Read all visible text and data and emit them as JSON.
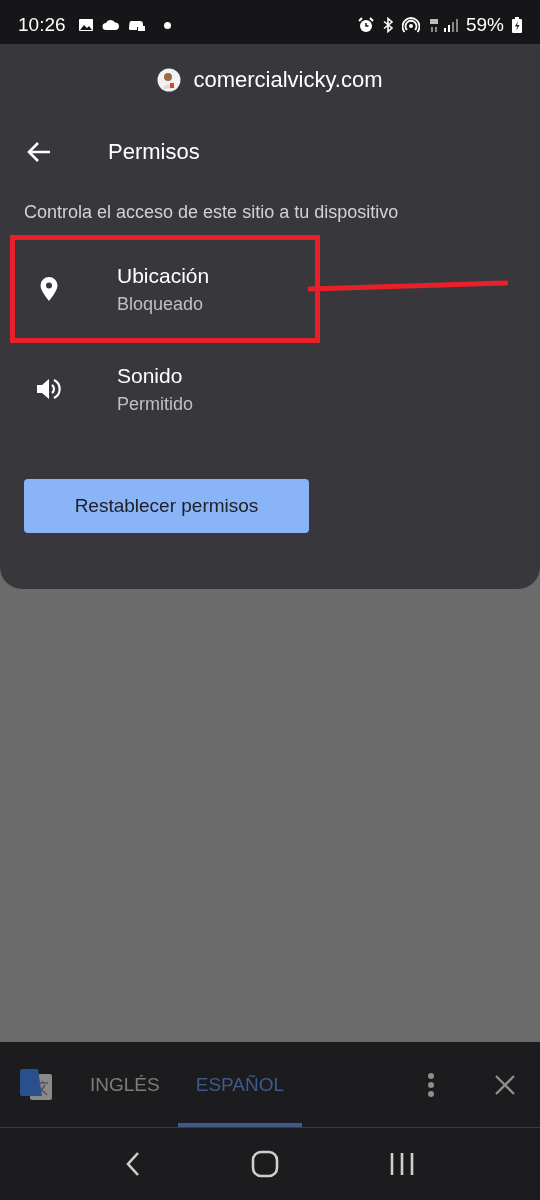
{
  "status_bar": {
    "time": "10:26",
    "battery": "59%"
  },
  "site": {
    "domain": "comercialvicky.com"
  },
  "header": {
    "title": "Permisos"
  },
  "description": "Controla el acceso de este sitio a tu dispositivo",
  "permissions": [
    {
      "kind": "location",
      "name": "Ubicación",
      "state": "Bloqueado",
      "annotated": true
    },
    {
      "kind": "sound",
      "name": "Sonido",
      "state": "Permitido",
      "annotated": false
    }
  ],
  "reset_button": "Restablecer permisos",
  "translate_bar": {
    "languages": [
      {
        "label": "INGLÉS",
        "selected": false
      },
      {
        "label": "ESPAÑOL",
        "selected": true
      }
    ]
  }
}
